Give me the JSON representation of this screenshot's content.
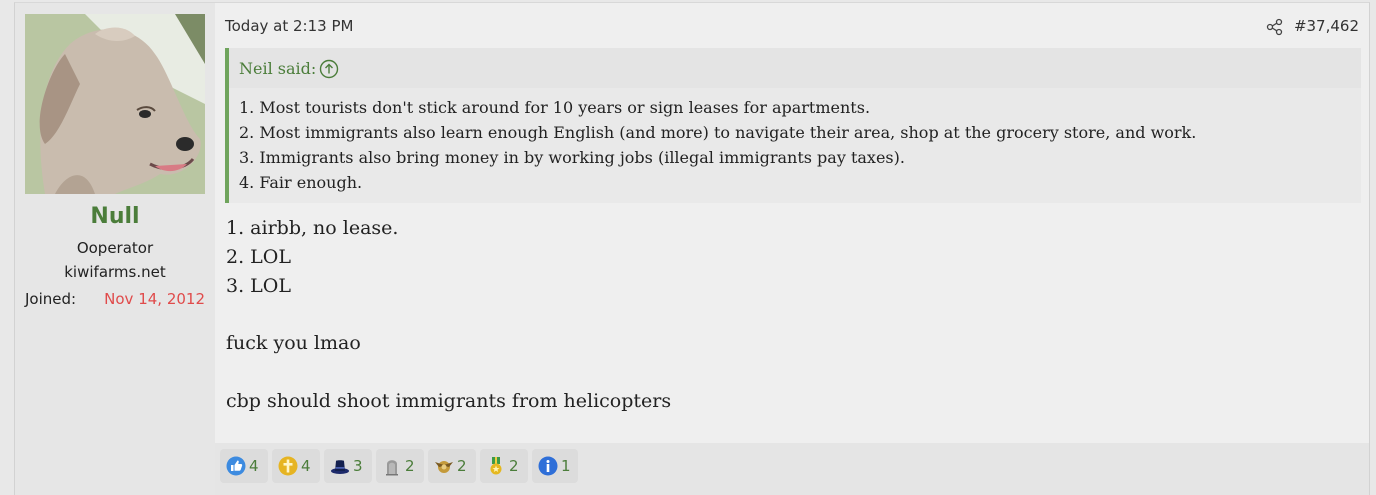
{
  "user": {
    "name": "Null",
    "title": "Ooperator",
    "banner": "kiwifarms.net",
    "joined_label": "Joined:",
    "joined_date": "Nov 14, 2012"
  },
  "post": {
    "date": "Today at 2:13 PM",
    "number": "#37,462",
    "quote": {
      "author": "Neil said:",
      "lines": [
        "1. Most tourists don't stick around for 10 years or sign leases for apartments.",
        "2. Most immigrants also learn enough English (and more) to navigate their area, shop at the grocery store, and work.",
        "3. Immigrants also bring money in by working jobs (illegal immigrants pay taxes).",
        "4. Fair enough."
      ]
    },
    "body": [
      "1. airbb, no lease.",
      "2. LOL",
      "3. LOL",
      "fuck you lmao",
      "cbp should shoot immigrants from helicopters"
    ]
  },
  "reactions": [
    {
      "icon": "thumbs-up-icon",
      "count": "4"
    },
    {
      "icon": "cross-icon",
      "count": "4"
    },
    {
      "icon": "top-hat-icon",
      "count": "3"
    },
    {
      "icon": "gravestone-icon",
      "count": "2"
    },
    {
      "icon": "eagle-icon",
      "count": "2"
    },
    {
      "icon": "medal-icon",
      "count": "2"
    },
    {
      "icon": "info-icon",
      "count": "1"
    }
  ],
  "colors": {
    "username": "#4b7d3a",
    "joined_date": "#e04b4b",
    "quote_border": "#6fa45c"
  }
}
